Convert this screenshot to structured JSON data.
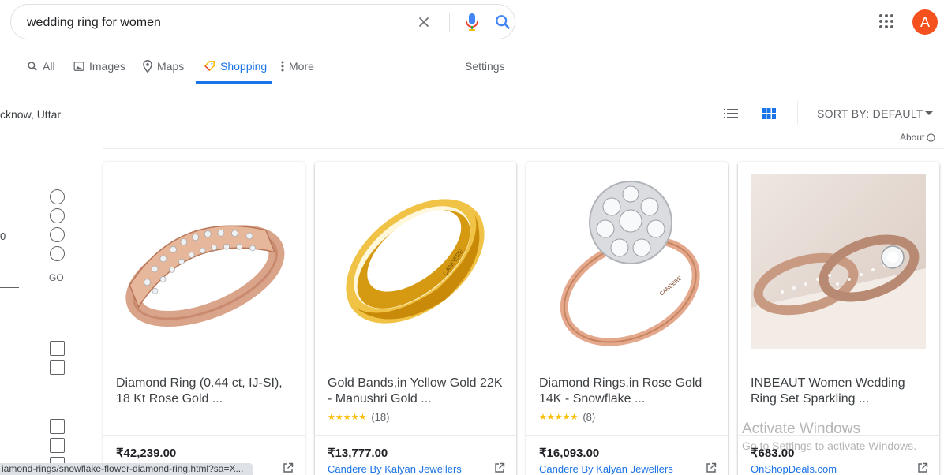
{
  "search": {
    "query": "wedding ring for women",
    "placeholder": ""
  },
  "account": {
    "avatar_letter": "A",
    "avatar_color": "#f4511e"
  },
  "tabs": [
    {
      "label": "All",
      "icon": "search-icon"
    },
    {
      "label": "Images",
      "icon": "image-icon"
    },
    {
      "label": "Maps",
      "icon": "map-pin-icon"
    },
    {
      "label": "Shopping",
      "icon": "tag-icon",
      "active": true
    },
    {
      "label": "More",
      "icon": "more-vert-icon"
    }
  ],
  "settings_label": "Settings",
  "filters": {
    "location": "cknow, Uttar",
    "price_zero": "0",
    "go_label": "GO"
  },
  "toolbar": {
    "sort_label": "SORT BY: DEFAULT",
    "about_label": "About"
  },
  "products": [
    {
      "title": "Diamond Ring (0.44 ct, IJ-SI), 18 Kt Rose Gold ...",
      "rating_stars": "★★★★★",
      "review_count": "",
      "price": "₹42,239.00",
      "seller": ""
    },
    {
      "title": "Gold Bands,in Yellow Gold 22K - Manushri Gold ...",
      "rating_stars": "★★★★★",
      "review_count": "(18)",
      "price": "₹13,777.00",
      "seller": "Candere By Kalyan Jewellers"
    },
    {
      "title": "Diamond Rings,in Rose Gold 14K - Snowflake ...",
      "rating_stars": "★★★★★",
      "review_count": "(8)",
      "price": "₹16,093.00",
      "seller": "Candere By Kalyan Jewellers"
    },
    {
      "title": "INBEAUT Women Wedding Ring Set Sparkling ...",
      "rating_stars": "",
      "review_count": "",
      "price": "₹683.00",
      "seller": "OnShopDeals.com"
    }
  ],
  "status_url": "iamond-rings/snowflake-flower-diamond-ring.html?sa=X...",
  "watermark": {
    "title": "Activate Windows",
    "subtitle": "Go to Settings to activate Windows."
  },
  "colors": {
    "accent": "#1a73e8",
    "star": "#fbbc04"
  }
}
